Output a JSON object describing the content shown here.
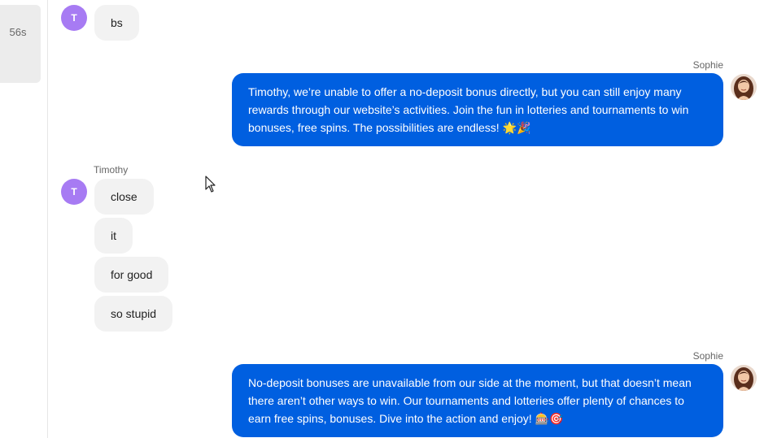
{
  "sidebar": {
    "timer": "56s"
  },
  "messages": [
    {
      "sender": "",
      "avatar_initial": "T",
      "bubbles": [
        "bs"
      ]
    },
    {
      "sender": "Sophie",
      "text": "Timothy, we’re unable to offer a no-deposit bonus directly, but you can still enjoy many rewards through our website’s activities. Join the fun in lotteries and tournaments to win bonuses, free spins. The possibilities are endless! 🌟🎉"
    },
    {
      "sender": "Timothy",
      "avatar_initial": "T",
      "bubbles": [
        "close",
        "it",
        "for good",
        "so stupid"
      ]
    },
    {
      "sender": "Sophie",
      "text": "No-deposit bonuses are unavailable from our side at the moment, but that doesn’t mean there aren’t other ways to win. Our tournaments and lotteries offer plenty of chances to earn free spins, bonuses. Dive into the action and enjoy! 🎰🎯"
    }
  ],
  "colors": {
    "agent_bubble": "#005fe0",
    "user_bubble": "#f2f2f2",
    "user_avatar": "#a77bf3"
  },
  "icons": [
    "agent-avatar-photo",
    "mouse-cursor"
  ]
}
